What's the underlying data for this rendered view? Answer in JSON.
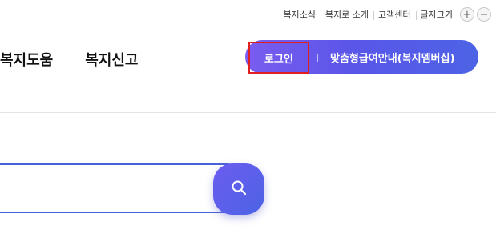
{
  "utility": {
    "links": [
      "복지소식",
      "복지로 소개",
      "고객센터"
    ],
    "font_size_label": "글자크기",
    "zoom_in": "+",
    "zoom_out": "−"
  },
  "gnb": {
    "items": [
      "복지도움",
      "복지신고"
    ]
  },
  "actions": {
    "login_label": "로그인",
    "benefit_label": "맞춤형급여안내(복지멤버십)"
  },
  "search": {
    "value": "",
    "placeholder": ""
  },
  "colors": {
    "accent": "#5a56e8",
    "accent_gradient_start": "#7b5cf0",
    "accent_gradient_end": "#4d63e6",
    "search_border": "#4a62d8",
    "highlight_box": "#e02020"
  },
  "icons": {
    "search_button": "search-icon",
    "zoom_in": "plus-icon",
    "zoom_out": "minus-icon"
  }
}
